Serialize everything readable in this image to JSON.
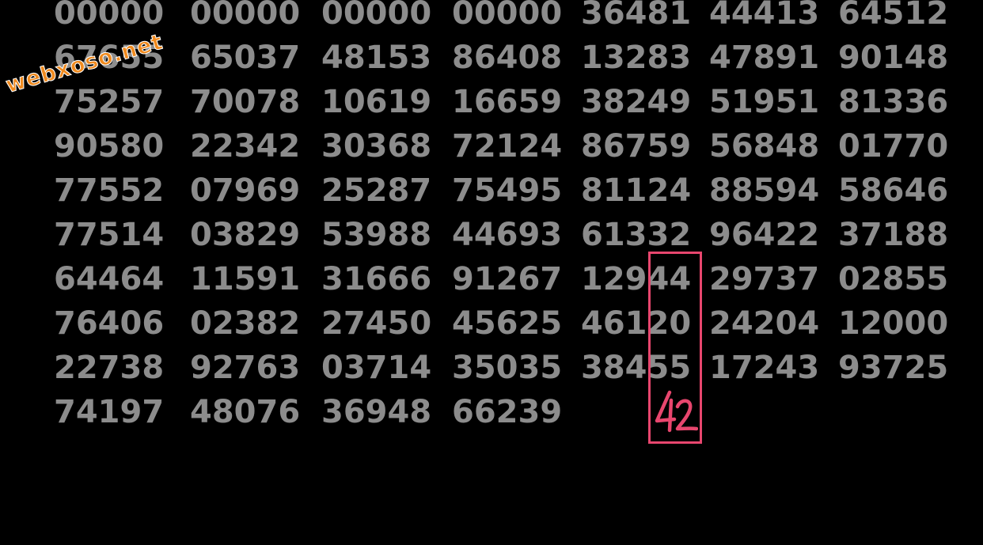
{
  "logo_text": "webxoso.net",
  "grid_rows": [
    [
      "00000",
      "00000",
      "00000",
      "00000",
      "36481",
      "44413",
      "64512"
    ],
    [
      "67655",
      "65037",
      "48153",
      "86408",
      "13283",
      "47891",
      "90148"
    ],
    [
      "75257",
      "70078",
      "10619",
      "16659",
      "38249",
      "51951",
      "81336"
    ],
    [
      "90580",
      "22342",
      "30368",
      "72124",
      "86759",
      "56848",
      "01770"
    ],
    [
      "77552",
      "07969",
      "25287",
      "75495",
      "81124",
      "88594",
      "58646"
    ],
    [
      "77514",
      "03829",
      "53988",
      "44693",
      "61332",
      "96422",
      "37188"
    ],
    [
      "64464",
      "11591",
      "31666",
      "91267",
      "12944",
      "29737",
      "02855"
    ],
    [
      "76406",
      "02382",
      "27450",
      "45625",
      "46120",
      "24204",
      "12000"
    ],
    [
      "22738",
      "92763",
      "03714",
      "35035",
      "38455",
      "17243",
      "93725"
    ],
    [
      "74197",
      "48076",
      "36948",
      "66239"
    ]
  ],
  "handwritten_note": "42",
  "colors": {
    "background": "#000000",
    "numbers": "#8c8c8c",
    "highlight": "#e8466e",
    "logo": "#f08a1e"
  }
}
